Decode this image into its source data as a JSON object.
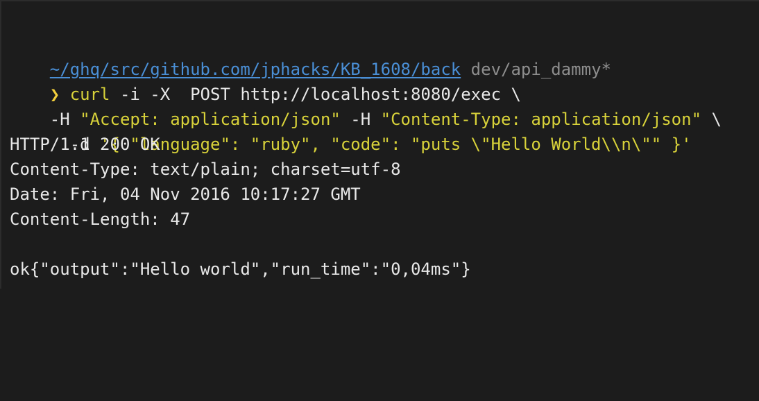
{
  "colors": {
    "background": "#1c1c1c",
    "path": "#4a8fd6",
    "branch": "#8d8d8d",
    "prompt": "#f2cf3c",
    "command": "#d8d23a",
    "text": "#e8e8e8"
  },
  "prompt": {
    "path": "~/ghq/src/github.com/jphacks/KB_1608/back",
    "branch": "dev/api_dammy*",
    "symbol": "❯",
    "command_name": "curl",
    "line1_rest": " -i -X  POST http://localhost:8080/exec \\",
    "line2_flag_h1": "-H ",
    "line2_header1": "\"Accept: application/json\"",
    "line2_flag_h2": " -H ",
    "line2_header2": "\"Content-Type: application/json\"",
    "line2_tail": " \\",
    "line3_flag_d": "  -d ",
    "line3_body": "'{ \"language\": \"ruby\", \"code\": \"puts \\\"Hello World\\\\n\\\"\" }'"
  },
  "output": {
    "status": "HTTP/1.1 200 OK",
    "content_type": "Content-Type: text/plain; charset=utf-8",
    "date": "Date: Fri, 04 Nov 2016 10:17:27 GMT",
    "content_length": "Content-Length: 47",
    "body": "ok{\"output\":\"Hello world\",\"run_time\":\"0,04ms\"}"
  }
}
